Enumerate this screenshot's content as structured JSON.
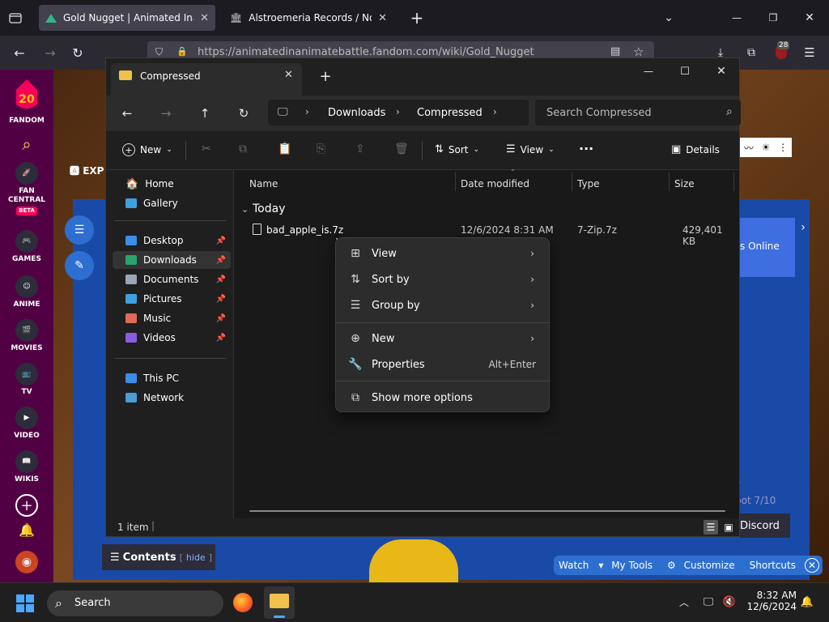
{
  "browser": {
    "tabs": [
      {
        "title": "Gold Nugget | Animated Inanin",
        "active": true
      },
      {
        "title": "Alstroemeria Records / Nomico",
        "active": false
      }
    ],
    "url": "https://animatedinanimatebattle.fandom.com/wiki/Gold_Nugget",
    "notification_count": "28"
  },
  "fandom": {
    "logo_text": "FANDOM",
    "items": [
      {
        "label": "FAN CENTRAL",
        "badge": "BETA"
      },
      {
        "label": "GAMES"
      },
      {
        "label": "ANIME"
      },
      {
        "label": "MOVIES"
      },
      {
        "label": "TV"
      },
      {
        "label": "VIDEO"
      },
      {
        "label": "WIKIS"
      }
    ],
    "explore_label": "EXP",
    "online_text": "s Online",
    "discord_text": "Discord",
    "contents_label": "Contents",
    "contents_hide": "hide",
    "right_text_1": "y",
    "right_text_2": "bot 7/10",
    "toolbar": {
      "watch": "Watch",
      "my_tools": "My Tools",
      "customize": "Customize",
      "shortcuts": "Shortcuts"
    }
  },
  "explorer": {
    "tab_title": "Compressed",
    "breadcrumb": [
      "Downloads",
      "Compressed"
    ],
    "search_placeholder": "Search Compressed",
    "toolbar": {
      "new": "New",
      "sort": "Sort",
      "view": "View",
      "details": "Details"
    },
    "nav": {
      "home": "Home",
      "gallery": "Gallery",
      "quick": [
        {
          "label": "Desktop",
          "color": "#3a8ee6"
        },
        {
          "label": "Downloads",
          "color": "#2aa36b"
        },
        {
          "label": "Documents",
          "color": "#9aa7b5"
        },
        {
          "label": "Pictures",
          "color": "#3fa0e0"
        },
        {
          "label": "Music",
          "color": "#e06a5a"
        },
        {
          "label": "Videos",
          "color": "#8b5ce0"
        }
      ],
      "this_pc": "This PC",
      "network": "Network"
    },
    "columns": {
      "name": "Name",
      "date": "Date modified",
      "type": "Type",
      "size": "Size"
    },
    "group": "Today",
    "files": [
      {
        "name": "bad_apple_is.7z",
        "date": "12/6/2024 8:31 AM",
        "type": "7-Zip.7z",
        "size": "429,401 KB"
      }
    ],
    "status": "1 item"
  },
  "context_menu": {
    "items": [
      {
        "label": "View",
        "submenu": true
      },
      {
        "label": "Sort by",
        "submenu": true
      },
      {
        "label": "Group by",
        "submenu": true
      },
      {
        "label": "New",
        "submenu": true
      },
      {
        "label": "Properties",
        "shortcut": "Alt+Enter"
      },
      {
        "label": "Show more options"
      }
    ]
  },
  "taskbar": {
    "search_label": "Search",
    "time": "8:32 AM",
    "date": "12/6/2024"
  }
}
